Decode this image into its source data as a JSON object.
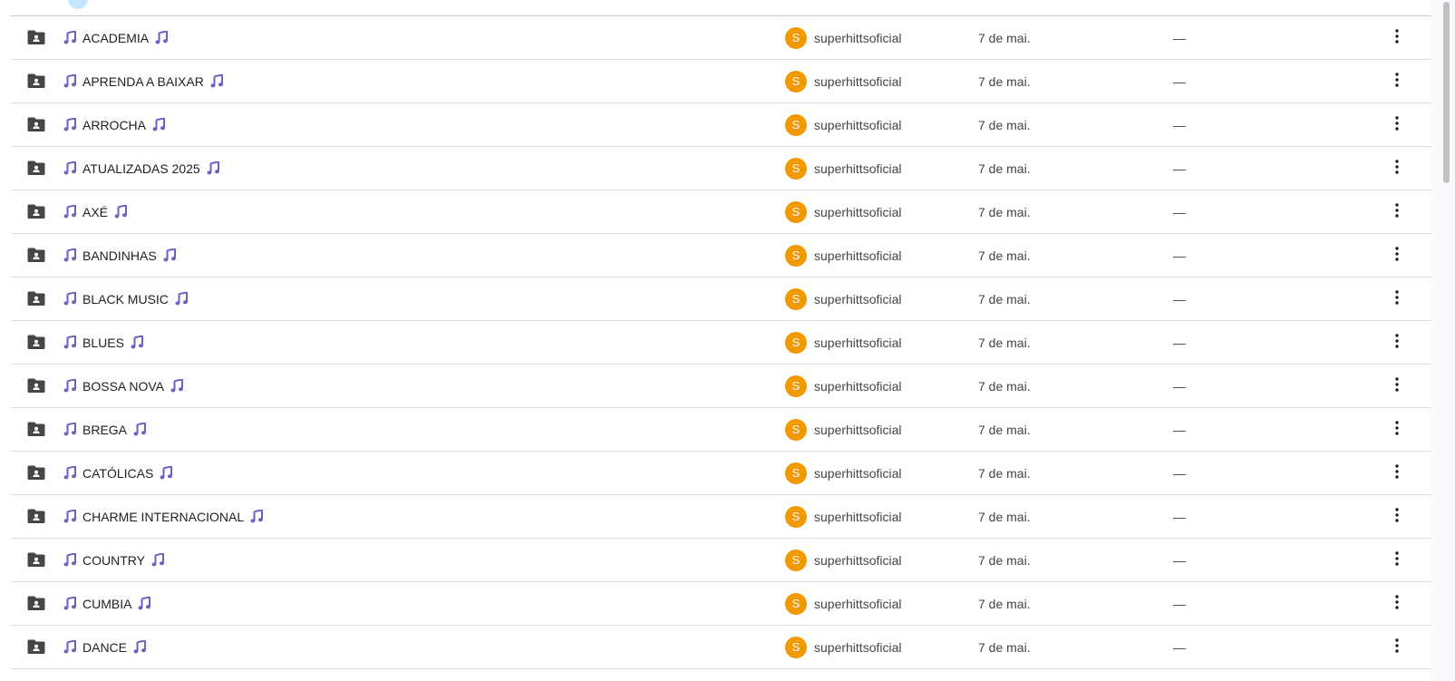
{
  "rows": [
    {
      "name": "ACADEMIA",
      "owner": "superhittsoficial",
      "avatar_letter": "S",
      "modified": "7 de mai.",
      "size": "—"
    },
    {
      "name": "APRENDA A BAIXAR",
      "owner": "superhittsoficial",
      "avatar_letter": "S",
      "modified": "7 de mai.",
      "size": "—"
    },
    {
      "name": "ARROCHA",
      "owner": "superhittsoficial",
      "avatar_letter": "S",
      "modified": "7 de mai.",
      "size": "—"
    },
    {
      "name": "ATUALIZADAS 2025",
      "owner": "superhittsoficial",
      "avatar_letter": "S",
      "modified": "7 de mai.",
      "size": "—"
    },
    {
      "name": "AXÉ",
      "owner": "superhittsoficial",
      "avatar_letter": "S",
      "modified": "7 de mai.",
      "size": "—"
    },
    {
      "name": "BANDINHAS",
      "owner": "superhittsoficial",
      "avatar_letter": "S",
      "modified": "7 de mai.",
      "size": "—"
    },
    {
      "name": "BLACK MUSIC",
      "owner": "superhittsoficial",
      "avatar_letter": "S",
      "modified": "7 de mai.",
      "size": "—"
    },
    {
      "name": "BLUES",
      "owner": "superhittsoficial",
      "avatar_letter": "S",
      "modified": "7 de mai.",
      "size": "—"
    },
    {
      "name": "BOSSA NOVA",
      "owner": "superhittsoficial",
      "avatar_letter": "S",
      "modified": "7 de mai.",
      "size": "—"
    },
    {
      "name": "BREGA",
      "owner": "superhittsoficial",
      "avatar_letter": "S",
      "modified": "7 de mai.",
      "size": "—"
    },
    {
      "name": "CATÓLICAS",
      "owner": "superhittsoficial",
      "avatar_letter": "S",
      "modified": "7 de mai.",
      "size": "—"
    },
    {
      "name": "CHARME INTERNACIONAL",
      "owner": "superhittsoficial",
      "avatar_letter": "S",
      "modified": "7 de mai.",
      "size": "—"
    },
    {
      "name": "COUNTRY",
      "owner": "superhittsoficial",
      "avatar_letter": "S",
      "modified": "7 de mai.",
      "size": "—"
    },
    {
      "name": "CUMBIA",
      "owner": "superhittsoficial",
      "avatar_letter": "S",
      "modified": "7 de mai.",
      "size": "—"
    },
    {
      "name": "DANCE",
      "owner": "superhittsoficial",
      "avatar_letter": "S",
      "modified": "7 de mai.",
      "size": "—"
    }
  ],
  "colors": {
    "avatar": "#f29900",
    "note_icon": "#6d5fc5",
    "folder_icon": "#444746",
    "text": "#1f1f1f",
    "secondary_text": "#444746"
  },
  "icons": {
    "folder": "shared-folder-icon",
    "note": "music-note-icon",
    "more": "more-vert-icon"
  }
}
